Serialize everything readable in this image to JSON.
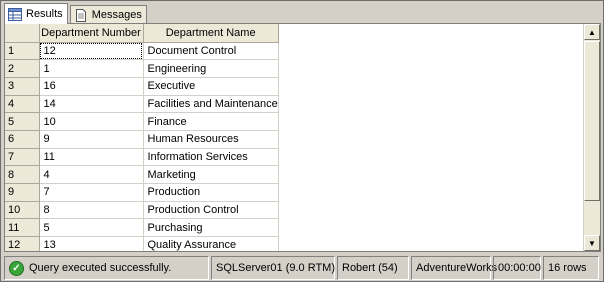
{
  "tabs": [
    {
      "label": "Results",
      "icon": "grid-icon"
    },
    {
      "label": "Messages",
      "icon": "document-icon"
    }
  ],
  "grid": {
    "columns": [
      "Department Number",
      "Department Name"
    ],
    "rows": [
      {
        "n": "1",
        "num": "12",
        "name": "Document Control"
      },
      {
        "n": "2",
        "num": "1",
        "name": "Engineering"
      },
      {
        "n": "3",
        "num": "16",
        "name": "Executive"
      },
      {
        "n": "4",
        "num": "14",
        "name": "Facilities and Maintenance"
      },
      {
        "n": "5",
        "num": "10",
        "name": "Finance"
      },
      {
        "n": "6",
        "num": "9",
        "name": "Human Resources"
      },
      {
        "n": "7",
        "num": "11",
        "name": "Information Services"
      },
      {
        "n": "8",
        "num": "4",
        "name": "Marketing"
      },
      {
        "n": "9",
        "num": "7",
        "name": "Production"
      },
      {
        "n": "10",
        "num": "8",
        "name": "Production Control"
      },
      {
        "n": "11",
        "num": "5",
        "name": "Purchasing"
      },
      {
        "n": "12",
        "num": "13",
        "name": "Quality Assurance"
      }
    ]
  },
  "status": {
    "message": "Query executed successfully.",
    "server": "SQLServer01 (9.0 RTM)",
    "user": "Robert (54)",
    "database": "AdventureWorks",
    "elapsed": "00:00:00",
    "rowcount": "16 rows",
    "success_color": "#3aa53a"
  }
}
